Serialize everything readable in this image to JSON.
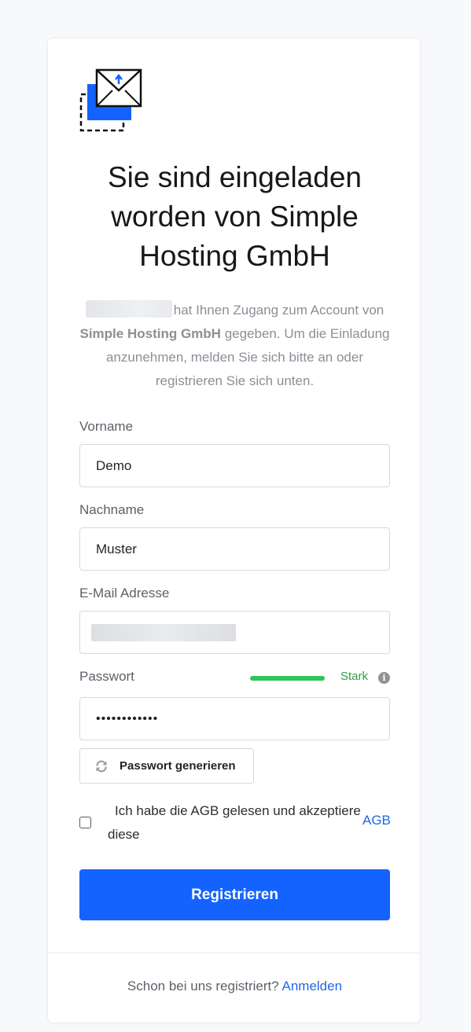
{
  "card": {
    "title": "Sie sind eingeladen worden von Simple Hosting GmbH",
    "intro_suffix": "hat Ihnen Zugang zum Account von",
    "intro_company": "Simple Hosting GmbH",
    "intro_rest": "gegeben. Um die Einladung anzunehmen, melden Sie sich bitte an oder registrieren Sie sich unten."
  },
  "form": {
    "firstname_label": "Vorname",
    "firstname_value": "Demo",
    "lastname_label": "Nachname",
    "lastname_value": "Muster",
    "email_label": "E-Mail Adresse",
    "password_label": "Passwort",
    "password_value": "••••••••••••",
    "strength_label": "Stark",
    "strength_level": 1.0,
    "strength_color": "#34c25a",
    "info_icon": "i",
    "generate_label": "Passwort generieren",
    "terms_text": "Ich habe die AGB gelesen und akzeptiere diese",
    "terms_link": "AGB",
    "submit_label": "Registrieren"
  },
  "footer": {
    "question": "Schon bei uns registriert?",
    "login_link": "Anmelden"
  },
  "colors": {
    "primary": "#1463ff",
    "link": "#2466e8"
  },
  "icons": [
    "invite-envelope-logo",
    "refresh-icon",
    "info-icon"
  ]
}
